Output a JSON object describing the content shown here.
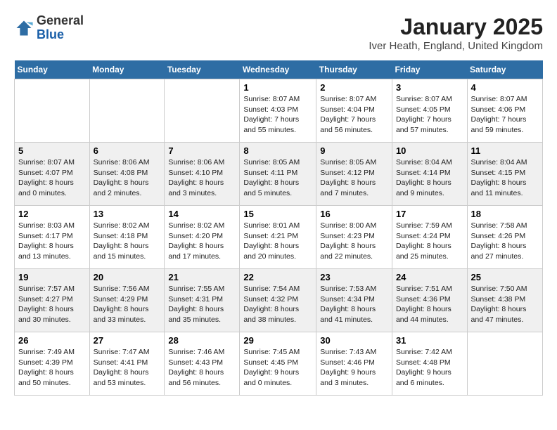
{
  "logo": {
    "general": "General",
    "blue": "Blue"
  },
  "title": "January 2025",
  "location": "Iver Heath, England, United Kingdom",
  "days_of_week": [
    "Sunday",
    "Monday",
    "Tuesday",
    "Wednesday",
    "Thursday",
    "Friday",
    "Saturday"
  ],
  "weeks": [
    [
      {
        "day": "",
        "info": ""
      },
      {
        "day": "",
        "info": ""
      },
      {
        "day": "",
        "info": ""
      },
      {
        "day": "1",
        "info": "Sunrise: 8:07 AM\nSunset: 4:03 PM\nDaylight: 7 hours\nand 55 minutes."
      },
      {
        "day": "2",
        "info": "Sunrise: 8:07 AM\nSunset: 4:04 PM\nDaylight: 7 hours\nand 56 minutes."
      },
      {
        "day": "3",
        "info": "Sunrise: 8:07 AM\nSunset: 4:05 PM\nDaylight: 7 hours\nand 57 minutes."
      },
      {
        "day": "4",
        "info": "Sunrise: 8:07 AM\nSunset: 4:06 PM\nDaylight: 7 hours\nand 59 minutes."
      }
    ],
    [
      {
        "day": "5",
        "info": "Sunrise: 8:07 AM\nSunset: 4:07 PM\nDaylight: 8 hours\nand 0 minutes."
      },
      {
        "day": "6",
        "info": "Sunrise: 8:06 AM\nSunset: 4:08 PM\nDaylight: 8 hours\nand 2 minutes."
      },
      {
        "day": "7",
        "info": "Sunrise: 8:06 AM\nSunset: 4:10 PM\nDaylight: 8 hours\nand 3 minutes."
      },
      {
        "day": "8",
        "info": "Sunrise: 8:05 AM\nSunset: 4:11 PM\nDaylight: 8 hours\nand 5 minutes."
      },
      {
        "day": "9",
        "info": "Sunrise: 8:05 AM\nSunset: 4:12 PM\nDaylight: 8 hours\nand 7 minutes."
      },
      {
        "day": "10",
        "info": "Sunrise: 8:04 AM\nSunset: 4:14 PM\nDaylight: 8 hours\nand 9 minutes."
      },
      {
        "day": "11",
        "info": "Sunrise: 8:04 AM\nSunset: 4:15 PM\nDaylight: 8 hours\nand 11 minutes."
      }
    ],
    [
      {
        "day": "12",
        "info": "Sunrise: 8:03 AM\nSunset: 4:17 PM\nDaylight: 8 hours\nand 13 minutes."
      },
      {
        "day": "13",
        "info": "Sunrise: 8:02 AM\nSunset: 4:18 PM\nDaylight: 8 hours\nand 15 minutes."
      },
      {
        "day": "14",
        "info": "Sunrise: 8:02 AM\nSunset: 4:20 PM\nDaylight: 8 hours\nand 17 minutes."
      },
      {
        "day": "15",
        "info": "Sunrise: 8:01 AM\nSunset: 4:21 PM\nDaylight: 8 hours\nand 20 minutes."
      },
      {
        "day": "16",
        "info": "Sunrise: 8:00 AM\nSunset: 4:23 PM\nDaylight: 8 hours\nand 22 minutes."
      },
      {
        "day": "17",
        "info": "Sunrise: 7:59 AM\nSunset: 4:24 PM\nDaylight: 8 hours\nand 25 minutes."
      },
      {
        "day": "18",
        "info": "Sunrise: 7:58 AM\nSunset: 4:26 PM\nDaylight: 8 hours\nand 27 minutes."
      }
    ],
    [
      {
        "day": "19",
        "info": "Sunrise: 7:57 AM\nSunset: 4:27 PM\nDaylight: 8 hours\nand 30 minutes."
      },
      {
        "day": "20",
        "info": "Sunrise: 7:56 AM\nSunset: 4:29 PM\nDaylight: 8 hours\nand 33 minutes."
      },
      {
        "day": "21",
        "info": "Sunrise: 7:55 AM\nSunset: 4:31 PM\nDaylight: 8 hours\nand 35 minutes."
      },
      {
        "day": "22",
        "info": "Sunrise: 7:54 AM\nSunset: 4:32 PM\nDaylight: 8 hours\nand 38 minutes."
      },
      {
        "day": "23",
        "info": "Sunrise: 7:53 AM\nSunset: 4:34 PM\nDaylight: 8 hours\nand 41 minutes."
      },
      {
        "day": "24",
        "info": "Sunrise: 7:51 AM\nSunset: 4:36 PM\nDaylight: 8 hours\nand 44 minutes."
      },
      {
        "day": "25",
        "info": "Sunrise: 7:50 AM\nSunset: 4:38 PM\nDaylight: 8 hours\nand 47 minutes."
      }
    ],
    [
      {
        "day": "26",
        "info": "Sunrise: 7:49 AM\nSunset: 4:39 PM\nDaylight: 8 hours\nand 50 minutes."
      },
      {
        "day": "27",
        "info": "Sunrise: 7:47 AM\nSunset: 4:41 PM\nDaylight: 8 hours\nand 53 minutes."
      },
      {
        "day": "28",
        "info": "Sunrise: 7:46 AM\nSunset: 4:43 PM\nDaylight: 8 hours\nand 56 minutes."
      },
      {
        "day": "29",
        "info": "Sunrise: 7:45 AM\nSunset: 4:45 PM\nDaylight: 9 hours\nand 0 minutes."
      },
      {
        "day": "30",
        "info": "Sunrise: 7:43 AM\nSunset: 4:46 PM\nDaylight: 9 hours\nand 3 minutes."
      },
      {
        "day": "31",
        "info": "Sunrise: 7:42 AM\nSunset: 4:48 PM\nDaylight: 9 hours\nand 6 minutes."
      },
      {
        "day": "",
        "info": ""
      }
    ]
  ]
}
